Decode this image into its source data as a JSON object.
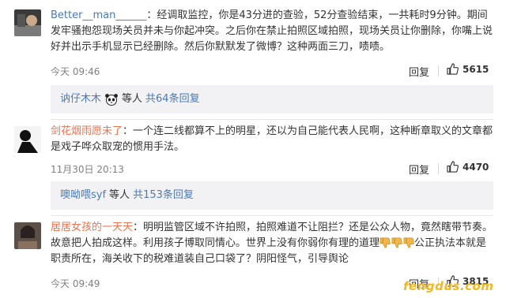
{
  "comments": [
    {
      "user": "Better__man______",
      "colon": "：",
      "text": "经调取监控，你是43分进的查验，52分查验结束，一共耗时9分钟。期间发牢骚抱怨现场关员并未与你起冲突。之后你在禁止拍照区域拍照，现场关员让你删除，你嘴上说好并出示手机显示已经删除。然后你默默发了微博？这种两面三刀，啧啧。",
      "time": "今天 09:46",
      "reply_label": "回复",
      "likes": "5615",
      "thread": {
        "user": "讷仔木木",
        "mid": "等人",
        "link": "共64条回复"
      }
    },
    {
      "user": "剑花烟雨愿未了",
      "colon": "：",
      "text": "一个连二线都算不上的明星，还以为自己能代表人民啊，这种断章取义的文章都是戏子哗众取宠的惯用手法。",
      "time": "11月30日 20:13",
      "reply_label": "回复",
      "likes": "4470",
      "thread": {
        "user": "噢呦喂syf",
        "mid": "等人",
        "link": "共153条回复"
      }
    },
    {
      "user": "居居女孩的一天天",
      "colon": "：",
      "text_a": "明明监管区域不许拍照，拍照难道不让阻拦？还是公众人物，竟然瞎带节奏。故意把人拍成这样。利用孩子博取同情心。世界上没有你弱你有理的道理",
      "text_b": "公正执法本就是职责所在，海关收下的税难道装自己口袋了？阴阳怪气，引导舆论",
      "time": "今天 09:49",
      "reply_label": "回复",
      "likes": "3815"
    }
  ],
  "watermark": "fengdus.com",
  "colors": {
    "username": "#eb7350",
    "link": "#4a7ab5",
    "meta": "#808080",
    "thread_bg": "#f2f2f5"
  }
}
